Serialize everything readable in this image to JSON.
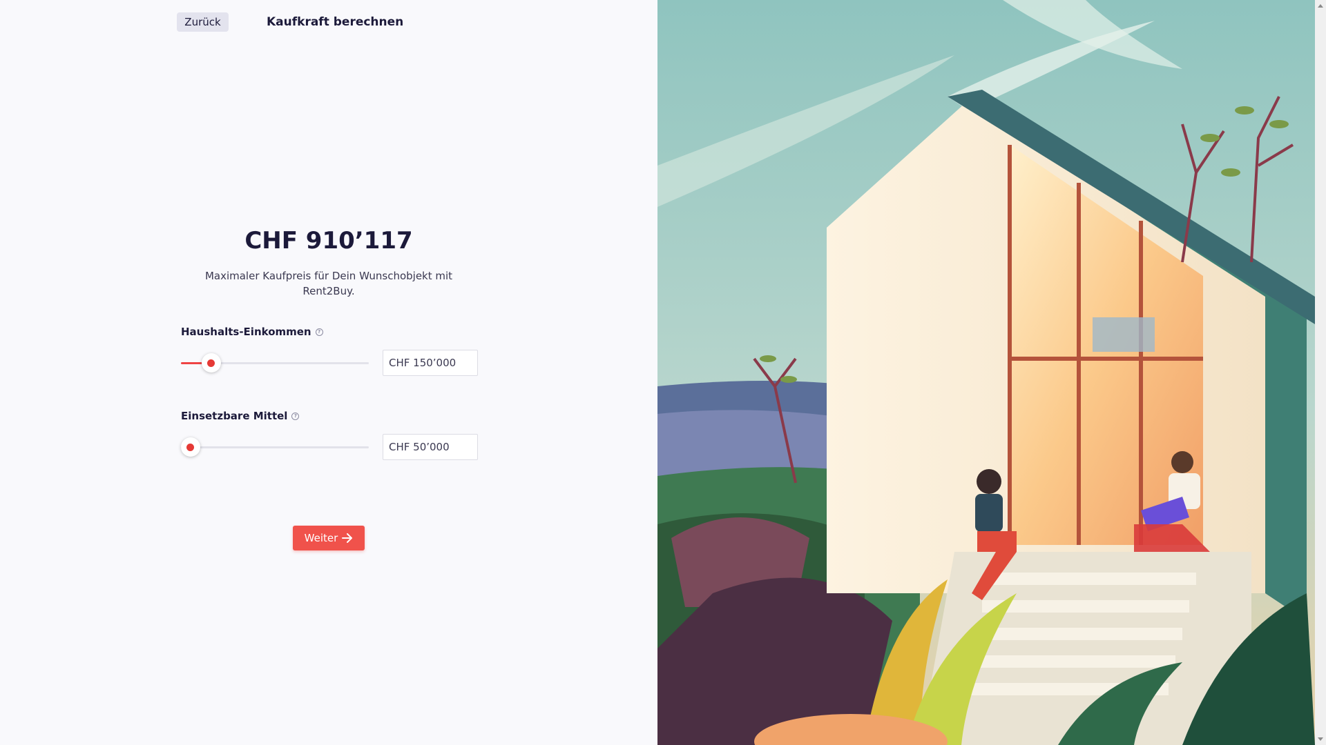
{
  "header": {
    "back_label": "Zurück",
    "title": "Kaufkraft berechnen"
  },
  "result": {
    "price": "CHF 910’117",
    "description": "Maximaler Kaufpreis für Dein Wunschobjekt mit Rent2Buy."
  },
  "income": {
    "label": "Haushalts-Einkommen",
    "value": "CHF 150’000",
    "slider_level": 0.16
  },
  "funds": {
    "label": "Einsetzbare Mittel",
    "value": "CHF 50’000",
    "slider_level": 0.05
  },
  "next_label": "Weiter",
  "colors": {
    "accent": "#ef4444",
    "button": "#f0524b",
    "text": "#1c1a3a",
    "background": "#f9f9fc"
  },
  "icons": {
    "info": "info-circle-icon",
    "next": "arrow-right-icon"
  }
}
